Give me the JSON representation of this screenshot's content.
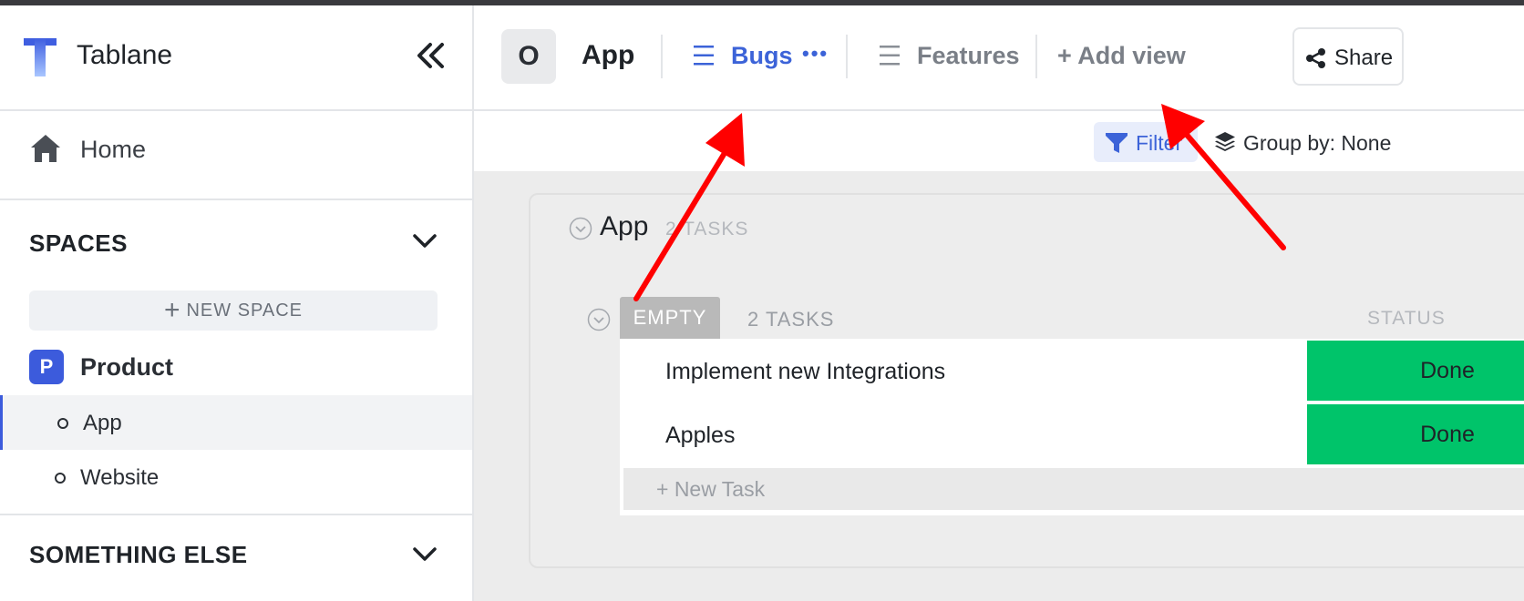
{
  "app": {
    "name": "Tablane"
  },
  "sidebar": {
    "home_label": "Home",
    "spaces_heading": "SPACES",
    "new_space_label": "NEW SPACE",
    "space": {
      "initial": "P",
      "label": "Product"
    },
    "lists": [
      {
        "label": "App",
        "active": true
      },
      {
        "label": "Website",
        "active": false
      }
    ],
    "something_else_heading": "SOMETHING ELSE"
  },
  "header": {
    "badge_letter": "O",
    "title": "App",
    "views": [
      {
        "label": "Bugs",
        "active": true
      },
      {
        "label": "Features",
        "active": false
      }
    ],
    "more_label": "•••",
    "add_view_label": "+ Add view",
    "share_label": "Share"
  },
  "toolbar": {
    "filter_label": "Filter",
    "group_by_label": "Group by: None"
  },
  "board": {
    "group_title": "App",
    "group_count": "2 TASKS",
    "status_badge": "EMPTY",
    "status_count": "2 TASKS",
    "status_column_header": "STATUS",
    "tasks": [
      {
        "name": "Implement new Integrations",
        "status": "Done"
      },
      {
        "name": "Apples",
        "status": "Done"
      }
    ],
    "new_task_label": "+ New Task"
  },
  "colors": {
    "accent": "#3c63d8",
    "done": "#00c46a",
    "annotation_arrow": "#ff0000"
  }
}
